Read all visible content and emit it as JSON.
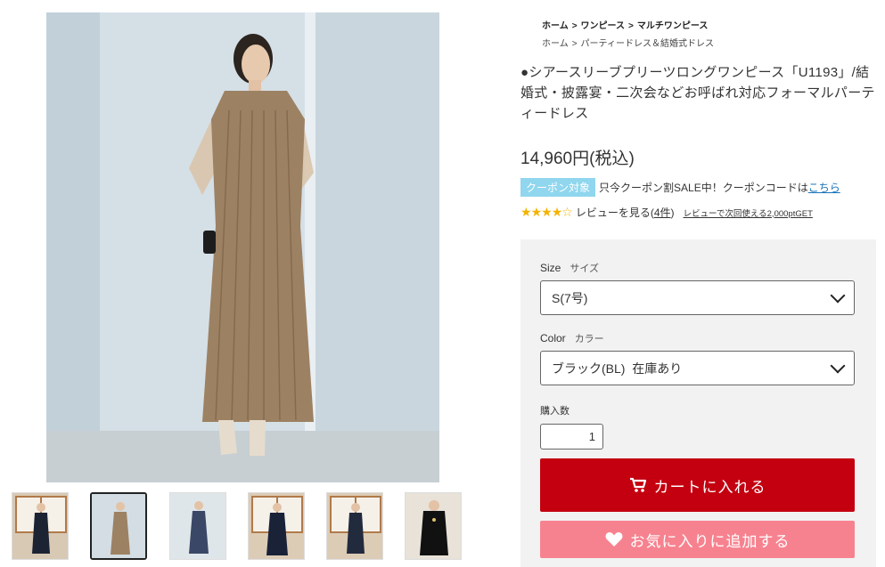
{
  "breadcrumb": {
    "row1": [
      "ホーム",
      "ワンピース",
      "マルチワンピース"
    ],
    "row2": [
      "ホーム",
      "パーティードレス＆結婚式ドレス"
    ],
    "separator": ">"
  },
  "product": {
    "title": "●シアースリーブプリーツロングワンピース「U1193」/結婚式・披露宴・二次会などお呼ばれ対応フォーマルパーティードレス",
    "price": "14,960円(税込)"
  },
  "coupon": {
    "badge": "クーポン対象",
    "text": "只今クーポン割SALE中！クーポンコードは",
    "link": "こちら"
  },
  "review": {
    "rating": 4,
    "max": 5,
    "link_text": "レビューを見る(",
    "count": "4件",
    "link_close": ")",
    "points": "レビューで次回使える2,000ptGET"
  },
  "form": {
    "size_label": "Size",
    "size_label_jp": "サイズ",
    "size_value": "S(7号)",
    "color_label": "Color",
    "color_label_jp": "カラー",
    "color_value": "ブラック(BL)  在庫あり",
    "qty_label": "購入数",
    "qty_value": "1",
    "cart_button": "カートに入れる",
    "fav_button": "お気に入りに追加する"
  },
  "thumbnails": [
    {
      "dress": "#1c2333",
      "active": false
    },
    {
      "dress": "#9c8163",
      "active": true
    },
    {
      "dress": "#3a4766",
      "active": false
    },
    {
      "dress": "#1a2238",
      "active": false
    },
    {
      "dress": "#222a3d",
      "active": false
    },
    {
      "dress": "#111111",
      "active": false
    }
  ],
  "colors": {
    "cart_red": "#c40010",
    "fav_pink": "#f7828f",
    "coupon_blue": "#8fd6ee",
    "star": "#f3b300",
    "dress_beige": "#9c8163"
  }
}
